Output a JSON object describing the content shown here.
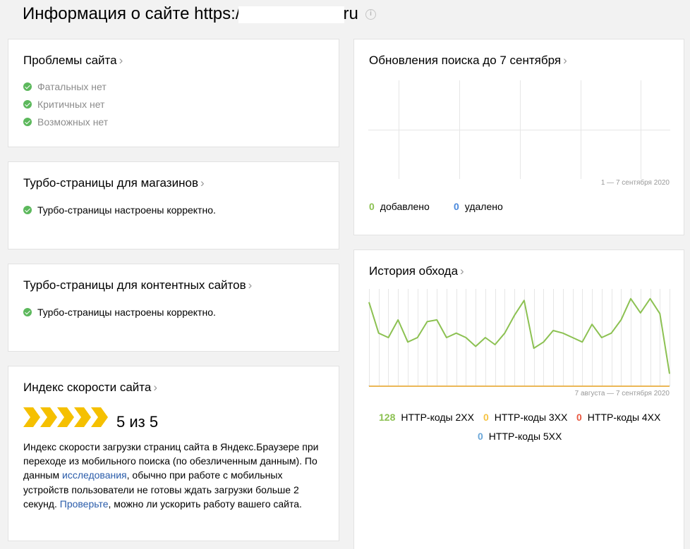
{
  "page": {
    "title_prefix": "Информация о сайте https:/",
    "title_suffix": "ru",
    "info_icon": "info-circle-icon"
  },
  "problems": {
    "title": "Проблемы сайта",
    "items": [
      "Фатальных нет",
      "Критичных нет",
      "Возможных нет"
    ]
  },
  "turbo_shops": {
    "title": "Турбо-страницы для магазинов",
    "status": "Турбо-страницы настроены корректно."
  },
  "turbo_content": {
    "title": "Турбо-страницы для контентных сайтов",
    "status": "Турбо-страницы настроены корректно."
  },
  "speed": {
    "title": "Индекс скорости сайта",
    "score": "5 из 5",
    "arrows_filled": 5,
    "text_part1": "Индекс скорости загрузки страниц сайта в Яндекс.Браузере при переходе из мобильного поиска (по обезличенным данным). По данным ",
    "link1": "исследования",
    "text_part2": ", обычно при работе с мобильных устройств пользователи не готовы ждать загрузки больше 2 секунд. ",
    "link2": "Проверьте",
    "text_part3": ", можно ли ускорить работу вашего сайта."
  },
  "search_updates": {
    "title": "Обновления поиска до 7 сентября",
    "period": "1 — 7 сентября 2020",
    "added_count": "0",
    "added_label": "добавлено",
    "removed_count": "0",
    "removed_label": "удалено"
  },
  "crawl_history": {
    "title": "История обхода",
    "period": "7 августа — 7 сентября 2020",
    "legend": [
      {
        "count": "128",
        "label": "HTTP-коды 2XX",
        "color": "#8cc152"
      },
      {
        "count": "0",
        "label": "HTTP-коды 3XX",
        "color": "#f6c342"
      },
      {
        "count": "0",
        "label": "HTTP-коды 4XX",
        "color": "#e9573f"
      },
      {
        "count": "0",
        "label": "HTTP-коды 5XX",
        "color": "#6aa6d8"
      }
    ],
    "chart_data": {
      "type": "line",
      "series": [
        {
          "name": "HTTP-коды 2XX",
          "values": [
            9.5,
            6.0,
            5.5,
            7.5,
            5.0,
            5.5,
            7.3,
            7.5,
            5.5,
            6.0,
            5.5,
            4.5,
            5.5,
            4.7,
            6.0,
            8.0,
            9.7,
            4.3,
            5.0,
            6.3,
            6.0,
            5.5,
            5.0,
            7.0,
            5.5,
            6.0,
            7.5,
            9.9,
            8.3,
            9.9,
            8.2,
            1.4
          ]
        },
        {
          "name": "HTTP-коды 3XX",
          "values": [
            0,
            0,
            0,
            0,
            0,
            0,
            0,
            0,
            0,
            0,
            0,
            0,
            0,
            0,
            0,
            0,
            0,
            0,
            0,
            0,
            0,
            0,
            0,
            0,
            0,
            0,
            0,
            0,
            0,
            0,
            0,
            0
          ]
        },
        {
          "name": "HTTP-коды 4XX",
          "values": [
            0,
            0,
            0,
            0,
            0,
            0,
            0,
            0,
            0,
            0,
            0,
            0,
            0,
            0,
            0,
            0,
            0,
            0,
            0,
            0,
            0,
            0,
            0,
            0,
            0,
            0,
            0,
            0,
            0,
            0,
            0,
            0
          ]
        },
        {
          "name": "HTTP-коды 5XX",
          "values": [
            0,
            0,
            0,
            0,
            0,
            0,
            0,
            0,
            0,
            0,
            0,
            0,
            0,
            0,
            0,
            0,
            0,
            0,
            0,
            0,
            0,
            0,
            0,
            0,
            0,
            0,
            0,
            0,
            0,
            0,
            0,
            0
          ]
        }
      ],
      "ylim": [
        0,
        11
      ],
      "grid": true
    }
  }
}
